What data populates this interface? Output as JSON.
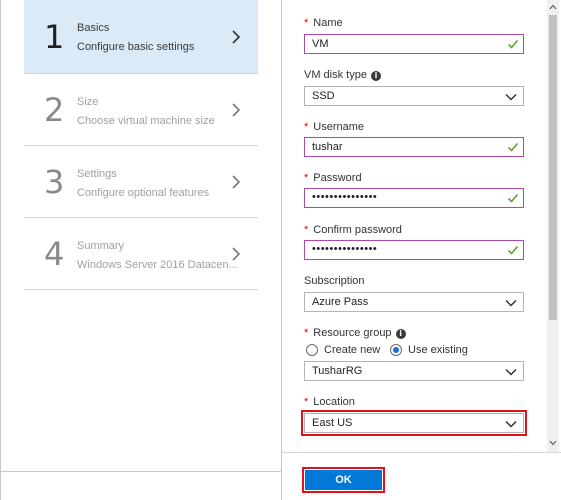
{
  "steps": [
    {
      "number": "1",
      "title": "Basics",
      "subtitle": "Configure basic settings",
      "active": true
    },
    {
      "number": "2",
      "title": "Size",
      "subtitle": "Choose virtual machine size",
      "active": false
    },
    {
      "number": "3",
      "title": "Settings",
      "subtitle": "Configure optional features",
      "active": false
    },
    {
      "number": "4",
      "title": "Summary",
      "subtitle": "Windows Server 2016 Datacen...",
      "active": false
    }
  ],
  "form": {
    "name": {
      "label": "Name",
      "value": "VM",
      "required": true
    },
    "disk_type": {
      "label": "VM disk type",
      "value": "SSD"
    },
    "username": {
      "label": "Username",
      "value": "tushar",
      "required": true
    },
    "password": {
      "label": "Password",
      "masked": "•••••••••••••••",
      "required": true
    },
    "confirm_password": {
      "label": "Confirm password",
      "masked": "•••••••••••••••",
      "required": true
    },
    "subscription": {
      "label": "Subscription",
      "value": "Azure Pass"
    },
    "resource_group": {
      "label": "Resource group",
      "required": true,
      "options": [
        "Create new",
        "Use existing"
      ],
      "selected": "Use existing",
      "value": "TusharRG"
    },
    "location": {
      "label": "Location",
      "value": "East US",
      "required": true
    }
  },
  "footer": {
    "ok_label": "OK"
  },
  "colors": {
    "accent": "#0078d7",
    "required": "#e00000",
    "valid_check": "#5ea226",
    "highlight": "#e1121b",
    "active_step_bg": "#dbeaf7"
  },
  "icons": {
    "step_chevron": "chevron-right-icon",
    "valid": "checkmark-icon",
    "dropdown": "chevron-down-icon",
    "info": "info-icon"
  }
}
